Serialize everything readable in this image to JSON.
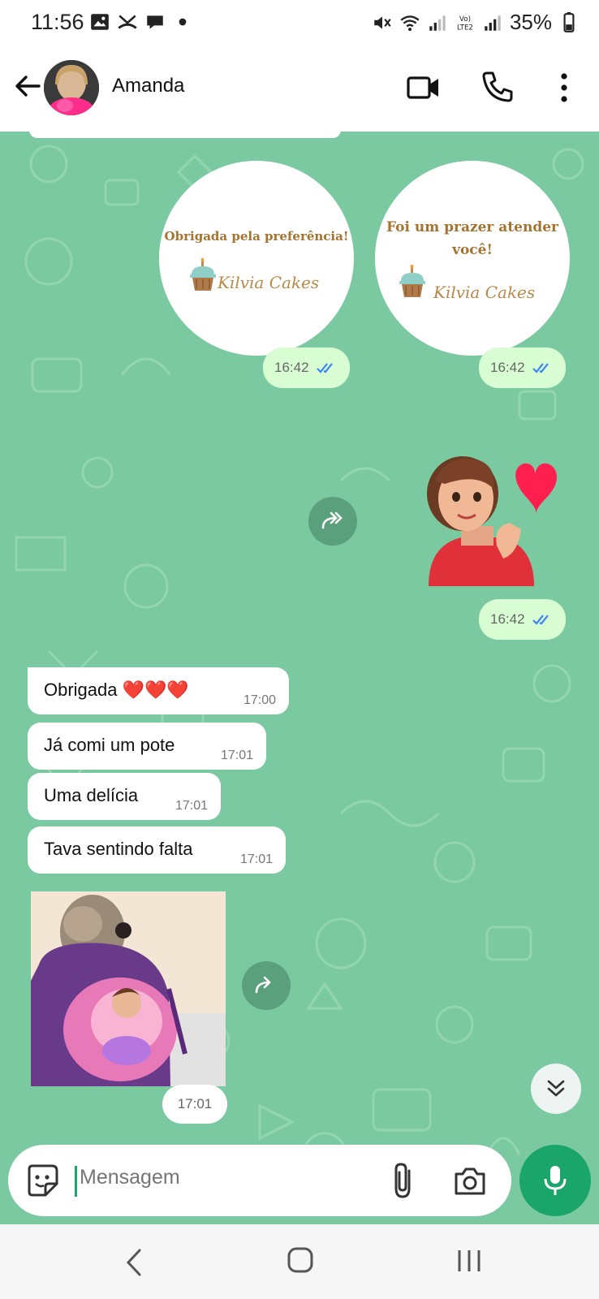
{
  "status_bar": {
    "time": "11:56",
    "battery": "35%",
    "network": "LTE2"
  },
  "header": {
    "contact_name": "Amanda"
  },
  "stickers": {
    "thanks": {
      "title": "Obrigada pela preferência!",
      "brand": "Kilvia Cakes",
      "time": "16:42"
    },
    "pleasure": {
      "title": "Foi um prazer atender você!",
      "brand": "Kilvia Cakes",
      "time": "16:42"
    },
    "avatar_heart": {
      "time": "16:42"
    }
  },
  "messages": [
    {
      "text": "Obrigada ❤️❤️❤️",
      "time": "17:00"
    },
    {
      "text": "Já comi um pote",
      "time": "17:01"
    },
    {
      "text": "Uma delícia",
      "time": "17:01"
    },
    {
      "text": "Tava sentindo falta",
      "time": "17:01"
    }
  ],
  "media": {
    "time": "17:01"
  },
  "composer": {
    "placeholder": "Mensagem"
  },
  "colors": {
    "chat_background": "#7ac9a0",
    "outgoing_bubble": "#d9fdd3",
    "accent": "#1aa56a",
    "read_ticks": "#3b82f6"
  },
  "icons": [
    "back-arrow-icon",
    "video-call-icon",
    "voice-call-icon",
    "more-options-icon",
    "forward-icon",
    "scroll-down-icon",
    "emoji-icon",
    "attach-icon",
    "camera-icon",
    "mic-icon"
  ]
}
